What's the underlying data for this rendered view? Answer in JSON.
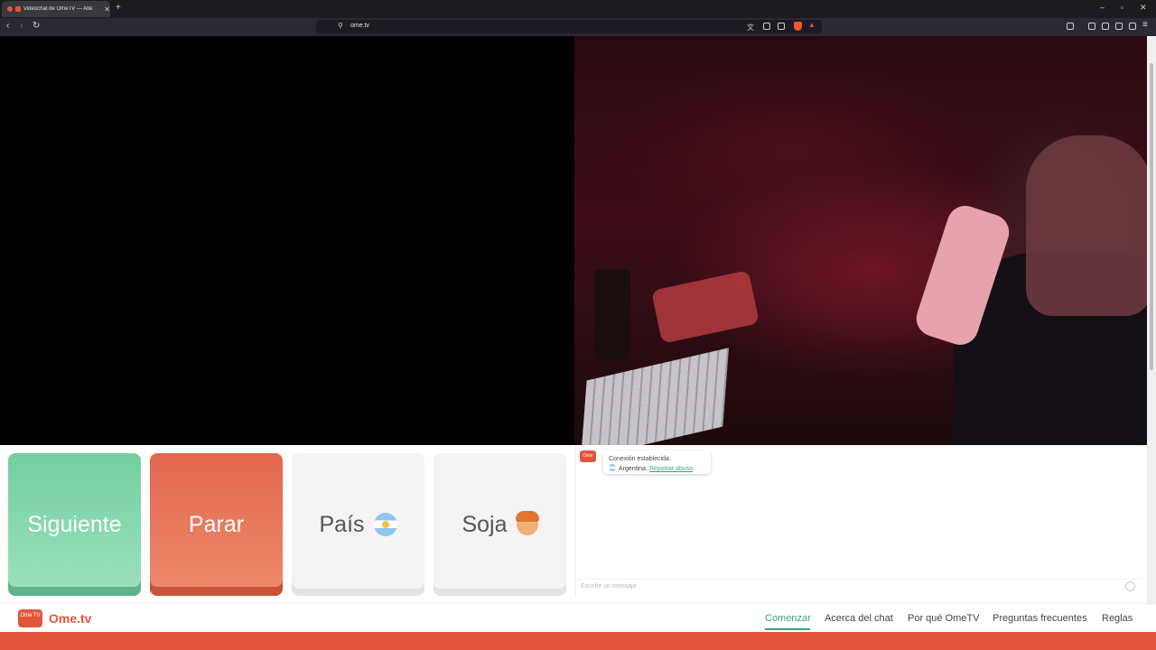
{
  "browser": {
    "tab_title": "Videochat de OmeTV — Alte",
    "url": "ome.tv"
  },
  "controls": {
    "next_label": "Siguiente",
    "stop_label": "Parar",
    "country_label": "País",
    "gender_label": "Soja"
  },
  "chat": {
    "logo_text": "Ome TV",
    "status": "Conexión establecida.",
    "country": "Argentina.",
    "report_link": "Reportar abuso",
    "input_placeholder": "Escribe un mensaje"
  },
  "footer": {
    "brand_icon_text": "Ome TV",
    "brand_name": "Ome.tv",
    "nav": [
      {
        "label": "Comenzar",
        "active": true
      },
      {
        "label": "Acerca del chat"
      },
      {
        "label": "Por qué OmeTV"
      },
      {
        "label": "Preguntas frecuentes"
      },
      {
        "label": "Reglas"
      }
    ]
  },
  "colors": {
    "next": "#7fd6a8",
    "stop": "#e8735a",
    "brand": "#e4563c",
    "link": "#3aa57a"
  }
}
